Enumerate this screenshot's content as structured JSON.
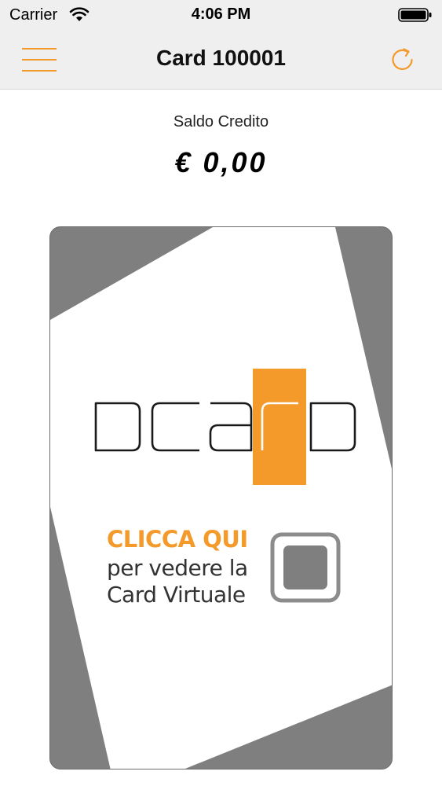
{
  "status_bar": {
    "carrier": "Carrier",
    "time": "4:06 PM",
    "wifi_icon": "wifi-icon",
    "battery_icon": "battery-icon"
  },
  "nav": {
    "title": "Card 100001",
    "menu_icon": "hamburger-menu-icon",
    "refresh_icon": "refresh-icon"
  },
  "balance": {
    "label": "Saldo Credito",
    "value": "€ 0,00"
  },
  "card": {
    "logo_text": "DCARD",
    "cta_title": "CLICCA QUI",
    "cta_line1": "per vedere la",
    "cta_line2": "Card Virtuale",
    "chip_icon": "card-chip-icon"
  },
  "colors": {
    "accent": "#f39a2a",
    "card_grey": "#7f7f80",
    "bar_bg": "#efeff0",
    "text": "#111111"
  }
}
